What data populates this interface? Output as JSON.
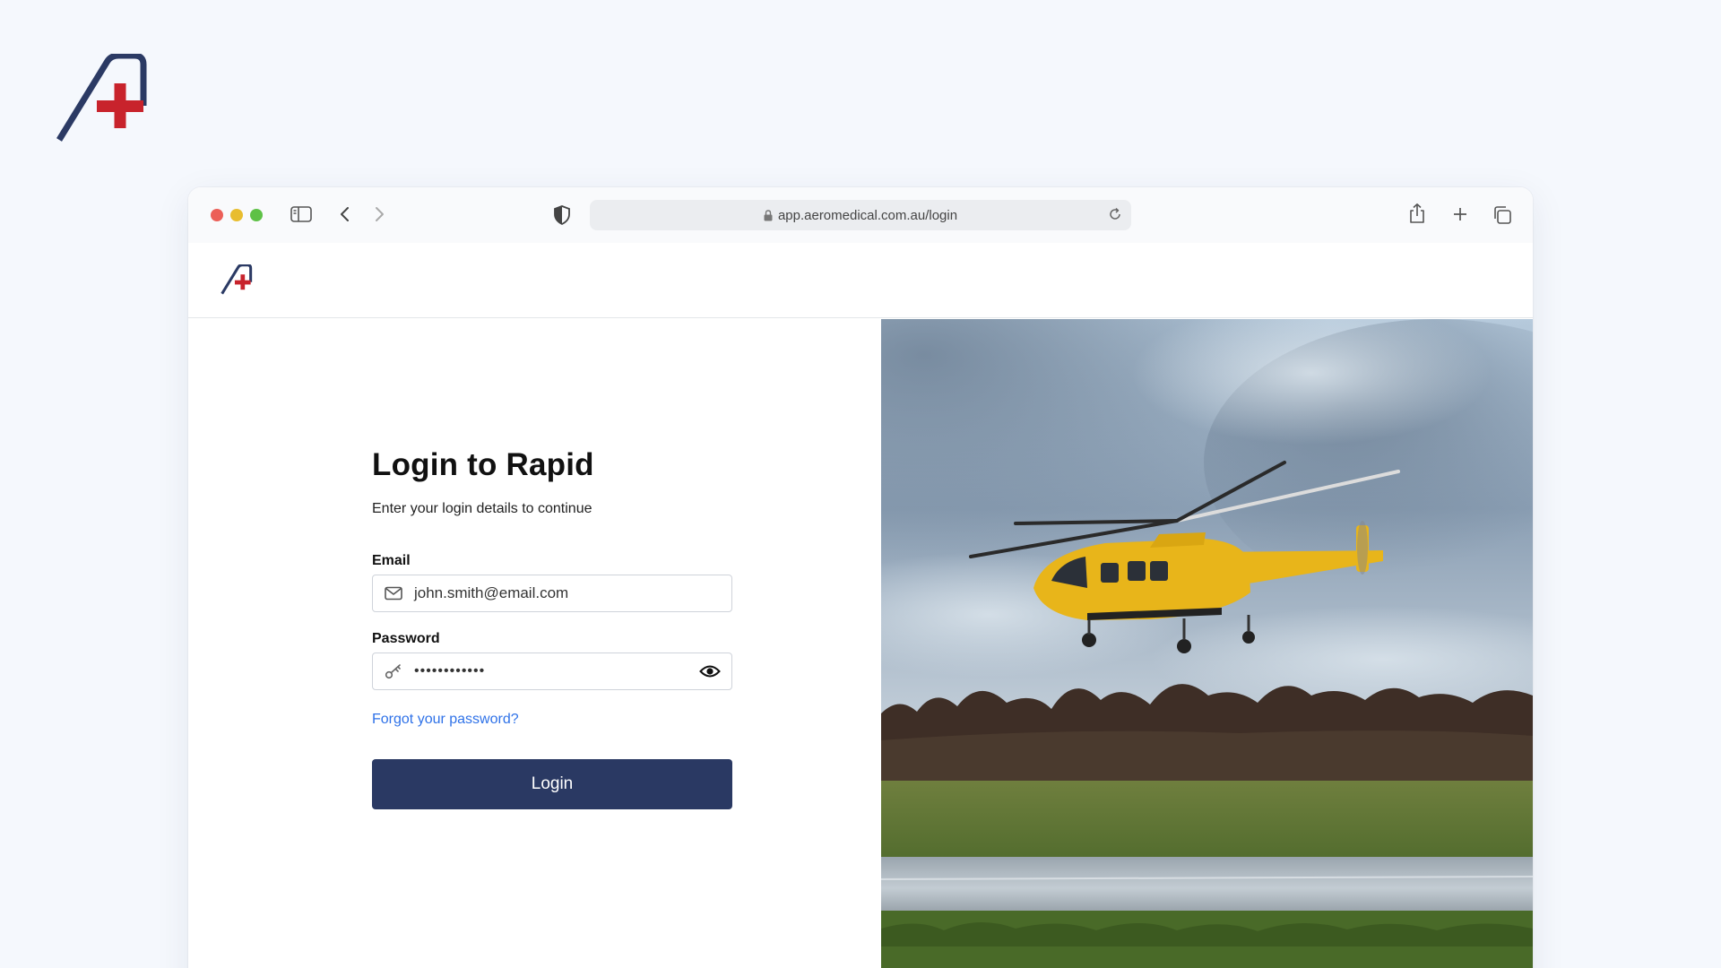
{
  "browser": {
    "url": "app.aeromedical.com.au/login"
  },
  "login": {
    "title": "Login to Rapid",
    "subtitle": "Enter your login details to continue",
    "email_label": "Email",
    "email_value": "john.smith@email.com",
    "password_label": "Password",
    "password_value": "••••••••••••",
    "forgot_link": "Forgot your password?",
    "submit_label": "Login"
  },
  "icons": {
    "brand": "aeromedical-logo",
    "email": "mail-icon",
    "password": "key-icon",
    "reveal": "eye-icon"
  },
  "colors": {
    "primary": "#2a3963",
    "link": "#2f72e8",
    "logo_navy": "#2b3a64",
    "logo_red": "#c8232c",
    "helicopter": "#e8b51a"
  }
}
